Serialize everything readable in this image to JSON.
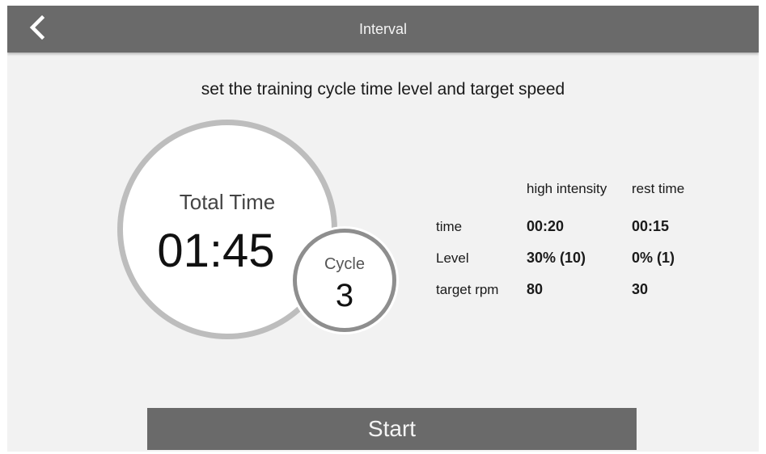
{
  "header": {
    "title": "Interval",
    "back_icon": "chevron-left-icon"
  },
  "subtitle": "set the training cycle time level and target speed",
  "total": {
    "label": "Total Time",
    "value": "01:45"
  },
  "cycle": {
    "label": "Cycle",
    "value": "3"
  },
  "settings": {
    "columns": [
      "high intensity",
      "rest time"
    ],
    "rows": [
      {
        "label": "time",
        "high": "00:20",
        "rest": "00:15"
      },
      {
        "label": "Level",
        "high": "30% (10)",
        "rest": "0% (1)"
      },
      {
        "label": "target rpm",
        "high": "80",
        "rest": "30"
      }
    ]
  },
  "start_button": {
    "label": "Start"
  },
  "colors": {
    "topbar": "#6a6a6a",
    "background": "#f2f2f2",
    "big_ring": "#bdbdbd",
    "small_ring": "#8e8e8e",
    "button": "#6a6a6a"
  }
}
